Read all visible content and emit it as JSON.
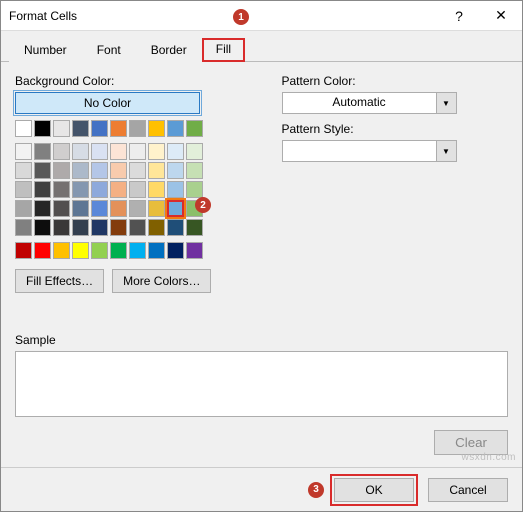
{
  "title": "Format Cells",
  "titlebar": {
    "help": "?",
    "close": "✕"
  },
  "tabs": [
    "Number",
    "Font",
    "Border",
    "Fill"
  ],
  "active_tab_index": 3,
  "labels": {
    "background_color": "Background Color:",
    "no_color": "No Color",
    "pattern_color": "Pattern Color:",
    "pattern_style": "Pattern Style:",
    "sample": "Sample"
  },
  "pattern_color": {
    "value": "Automatic"
  },
  "buttons": {
    "fill_effects": "Fill Effects…",
    "more_colors": "More Colors…",
    "clear": "Clear",
    "ok": "OK",
    "cancel": "Cancel"
  },
  "palette_themes_row1": [
    "#ffffff",
    "#000000",
    "#e7e6e6",
    "#44546a",
    "#4472c4",
    "#ed7d31",
    "#a5a5a5",
    "#ffc000",
    "#5b9bd5",
    "#70ad47"
  ],
  "palette_tints": [
    [
      "#f2f2f2",
      "#808080",
      "#d0cece",
      "#d6dce5",
      "#d9e1f2",
      "#fce4d6",
      "#ededed",
      "#fff2cc",
      "#ddebf7",
      "#e2efda"
    ],
    [
      "#d9d9d9",
      "#595959",
      "#aeaaaa",
      "#acb9ca",
      "#b4c6e7",
      "#f8cbad",
      "#dbdbdb",
      "#ffe699",
      "#bdd7ee",
      "#c6e0b4"
    ],
    [
      "#bfbfbf",
      "#404040",
      "#757171",
      "#8497b0",
      "#8ea9db",
      "#f4b084",
      "#c9c9c9",
      "#ffd966",
      "#9bc2e6",
      "#a9d08e"
    ],
    [
      "#a6a6a6",
      "#262626",
      "#524f4f",
      "#5e7694",
      "#5b88d8",
      "#e3915a",
      "#b0b0b0",
      "#e8bd3c",
      "#6fa9db",
      "#8bbf6a"
    ],
    [
      "#808080",
      "#0d0d0d",
      "#3a3838",
      "#333f4f",
      "#203764",
      "#833c0c",
      "#525252",
      "#806000",
      "#1f4e78",
      "#375623"
    ]
  ],
  "palette_standard": [
    "#c00000",
    "#ff0000",
    "#ffc000",
    "#ffff00",
    "#92d050",
    "#00b050",
    "#00b0f0",
    "#0070c0",
    "#002060",
    "#7030a0"
  ],
  "selected_swatch": {
    "row": 3,
    "col": 8
  },
  "callouts": {
    "c1": "1",
    "c2": "2",
    "c3": "3"
  },
  "watermark": "wsxdn.com"
}
